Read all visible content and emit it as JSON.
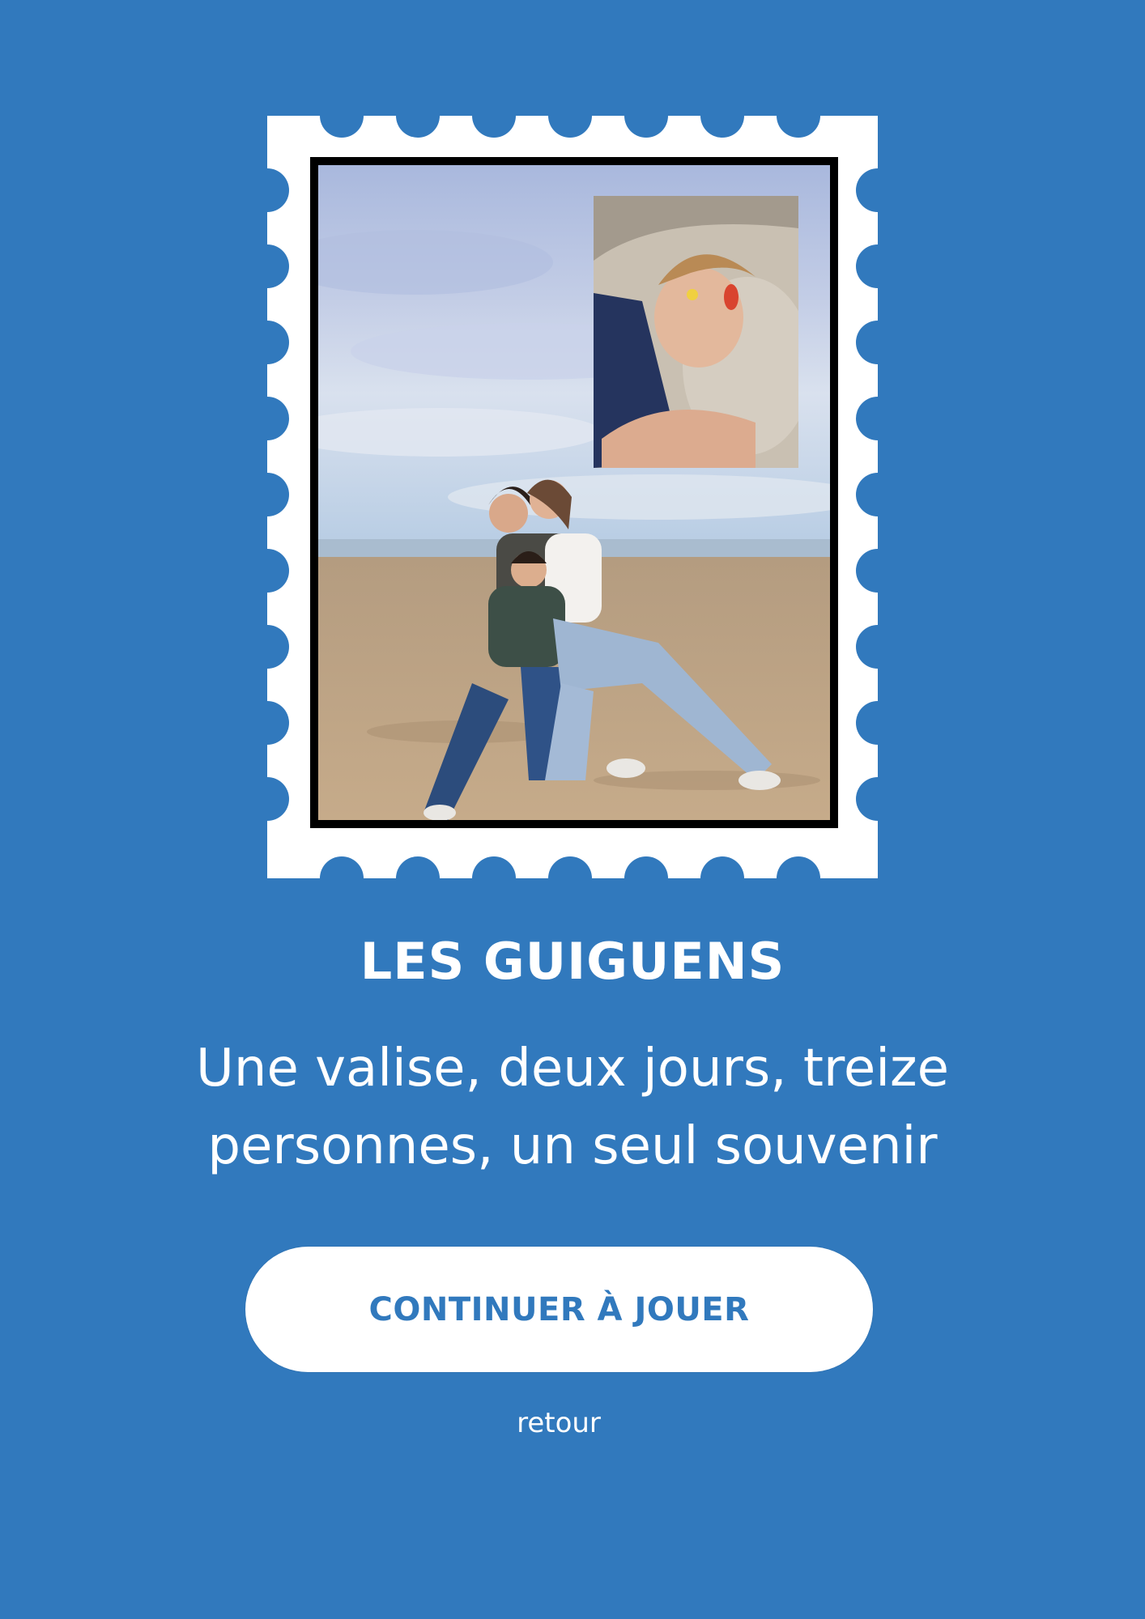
{
  "colors": {
    "background": "#3179bd",
    "stamp": "#ffffff",
    "frame": "#000000",
    "button_bg": "#ffffff",
    "button_text": "#3179bd",
    "text": "#ffffff"
  },
  "stamp": {
    "photo_description_icon": "family-beach-photo",
    "inset_icon": "sleeping-person-photo"
  },
  "card": {
    "title": "LES GUIGUENS",
    "subtitle": "Une valise, deux jours, treize personnes, un seul souvenir"
  },
  "actions": {
    "continue_label": "CONTINUER À JOUER",
    "back_label": "retour"
  }
}
